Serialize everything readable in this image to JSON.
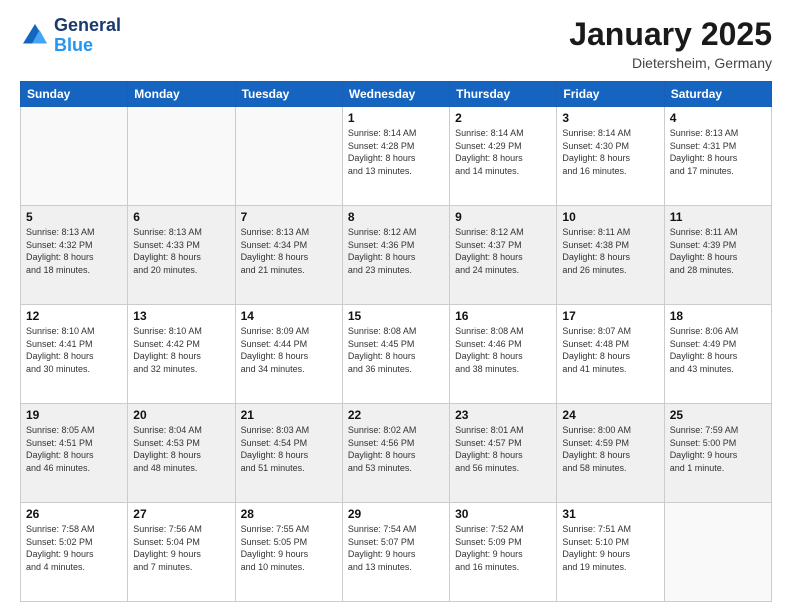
{
  "logo": {
    "line1": "General",
    "line2": "Blue"
  },
  "title": "January 2025",
  "subtitle": "Dietersheim, Germany",
  "headers": [
    "Sunday",
    "Monday",
    "Tuesday",
    "Wednesday",
    "Thursday",
    "Friday",
    "Saturday"
  ],
  "weeks": [
    [
      {
        "day": "",
        "info": ""
      },
      {
        "day": "",
        "info": ""
      },
      {
        "day": "",
        "info": ""
      },
      {
        "day": "1",
        "info": "Sunrise: 8:14 AM\nSunset: 4:28 PM\nDaylight: 8 hours\nand 13 minutes."
      },
      {
        "day": "2",
        "info": "Sunrise: 8:14 AM\nSunset: 4:29 PM\nDaylight: 8 hours\nand 14 minutes."
      },
      {
        "day": "3",
        "info": "Sunrise: 8:14 AM\nSunset: 4:30 PM\nDaylight: 8 hours\nand 16 minutes."
      },
      {
        "day": "4",
        "info": "Sunrise: 8:13 AM\nSunset: 4:31 PM\nDaylight: 8 hours\nand 17 minutes."
      }
    ],
    [
      {
        "day": "5",
        "info": "Sunrise: 8:13 AM\nSunset: 4:32 PM\nDaylight: 8 hours\nand 18 minutes."
      },
      {
        "day": "6",
        "info": "Sunrise: 8:13 AM\nSunset: 4:33 PM\nDaylight: 8 hours\nand 20 minutes."
      },
      {
        "day": "7",
        "info": "Sunrise: 8:13 AM\nSunset: 4:34 PM\nDaylight: 8 hours\nand 21 minutes."
      },
      {
        "day": "8",
        "info": "Sunrise: 8:12 AM\nSunset: 4:36 PM\nDaylight: 8 hours\nand 23 minutes."
      },
      {
        "day": "9",
        "info": "Sunrise: 8:12 AM\nSunset: 4:37 PM\nDaylight: 8 hours\nand 24 minutes."
      },
      {
        "day": "10",
        "info": "Sunrise: 8:11 AM\nSunset: 4:38 PM\nDaylight: 8 hours\nand 26 minutes."
      },
      {
        "day": "11",
        "info": "Sunrise: 8:11 AM\nSunset: 4:39 PM\nDaylight: 8 hours\nand 28 minutes."
      }
    ],
    [
      {
        "day": "12",
        "info": "Sunrise: 8:10 AM\nSunset: 4:41 PM\nDaylight: 8 hours\nand 30 minutes."
      },
      {
        "day": "13",
        "info": "Sunrise: 8:10 AM\nSunset: 4:42 PM\nDaylight: 8 hours\nand 32 minutes."
      },
      {
        "day": "14",
        "info": "Sunrise: 8:09 AM\nSunset: 4:44 PM\nDaylight: 8 hours\nand 34 minutes."
      },
      {
        "day": "15",
        "info": "Sunrise: 8:08 AM\nSunset: 4:45 PM\nDaylight: 8 hours\nand 36 minutes."
      },
      {
        "day": "16",
        "info": "Sunrise: 8:08 AM\nSunset: 4:46 PM\nDaylight: 8 hours\nand 38 minutes."
      },
      {
        "day": "17",
        "info": "Sunrise: 8:07 AM\nSunset: 4:48 PM\nDaylight: 8 hours\nand 41 minutes."
      },
      {
        "day": "18",
        "info": "Sunrise: 8:06 AM\nSunset: 4:49 PM\nDaylight: 8 hours\nand 43 minutes."
      }
    ],
    [
      {
        "day": "19",
        "info": "Sunrise: 8:05 AM\nSunset: 4:51 PM\nDaylight: 8 hours\nand 46 minutes."
      },
      {
        "day": "20",
        "info": "Sunrise: 8:04 AM\nSunset: 4:53 PM\nDaylight: 8 hours\nand 48 minutes."
      },
      {
        "day": "21",
        "info": "Sunrise: 8:03 AM\nSunset: 4:54 PM\nDaylight: 8 hours\nand 51 minutes."
      },
      {
        "day": "22",
        "info": "Sunrise: 8:02 AM\nSunset: 4:56 PM\nDaylight: 8 hours\nand 53 minutes."
      },
      {
        "day": "23",
        "info": "Sunrise: 8:01 AM\nSunset: 4:57 PM\nDaylight: 8 hours\nand 56 minutes."
      },
      {
        "day": "24",
        "info": "Sunrise: 8:00 AM\nSunset: 4:59 PM\nDaylight: 8 hours\nand 58 minutes."
      },
      {
        "day": "25",
        "info": "Sunrise: 7:59 AM\nSunset: 5:00 PM\nDaylight: 9 hours\nand 1 minute."
      }
    ],
    [
      {
        "day": "26",
        "info": "Sunrise: 7:58 AM\nSunset: 5:02 PM\nDaylight: 9 hours\nand 4 minutes."
      },
      {
        "day": "27",
        "info": "Sunrise: 7:56 AM\nSunset: 5:04 PM\nDaylight: 9 hours\nand 7 minutes."
      },
      {
        "day": "28",
        "info": "Sunrise: 7:55 AM\nSunset: 5:05 PM\nDaylight: 9 hours\nand 10 minutes."
      },
      {
        "day": "29",
        "info": "Sunrise: 7:54 AM\nSunset: 5:07 PM\nDaylight: 9 hours\nand 13 minutes."
      },
      {
        "day": "30",
        "info": "Sunrise: 7:52 AM\nSunset: 5:09 PM\nDaylight: 9 hours\nand 16 minutes."
      },
      {
        "day": "31",
        "info": "Sunrise: 7:51 AM\nSunset: 5:10 PM\nDaylight: 9 hours\nand 19 minutes."
      },
      {
        "day": "",
        "info": ""
      }
    ]
  ]
}
